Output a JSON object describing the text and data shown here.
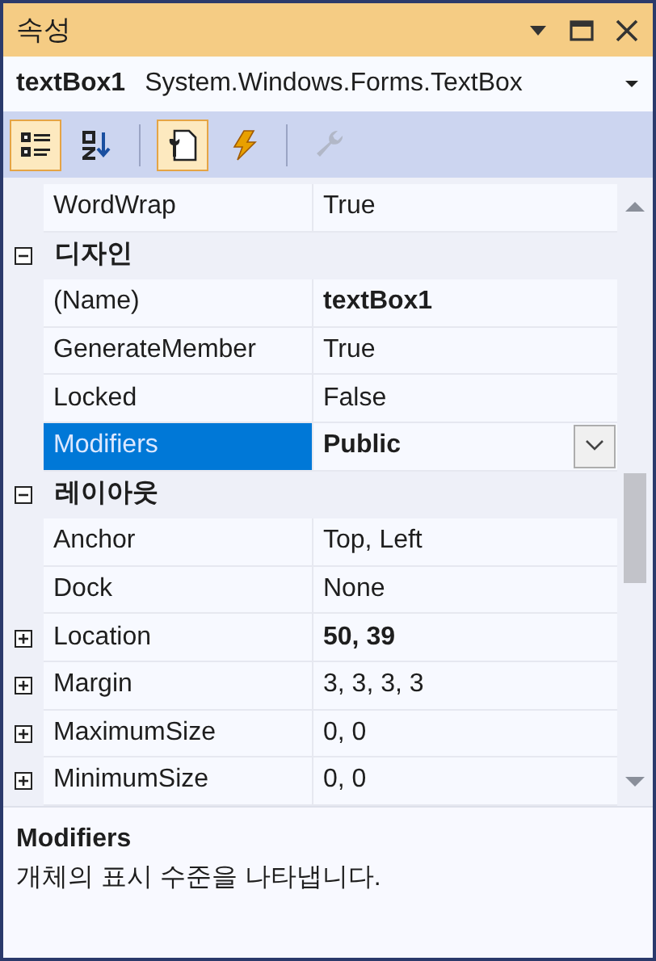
{
  "window": {
    "title": "속성"
  },
  "object_selector": {
    "name": "textBox1",
    "type": "System.Windows.Forms.TextBox"
  },
  "toolbar": [
    {
      "kind": "categorized",
      "selected": true,
      "disabled": false
    },
    {
      "kind": "alphabetical",
      "selected": false,
      "disabled": false
    },
    {
      "kind": "separator"
    },
    {
      "kind": "properties",
      "selected": true,
      "disabled": false
    },
    {
      "kind": "events",
      "selected": false,
      "disabled": false
    },
    {
      "kind": "separator"
    },
    {
      "kind": "property_pages",
      "selected": false,
      "disabled": true
    }
  ],
  "grid": {
    "rows": [
      {
        "kind": "property",
        "name": "WordWrap",
        "value": "True",
        "bold": false,
        "selected": false,
        "expandable": false
      },
      {
        "kind": "category",
        "name": "디자인",
        "expanded": true
      },
      {
        "kind": "property",
        "name": "(Name)",
        "value": "textBox1",
        "bold": true,
        "selected": false,
        "expandable": false
      },
      {
        "kind": "property",
        "name": "GenerateMember",
        "value": "True",
        "bold": false,
        "selected": false,
        "expandable": false
      },
      {
        "kind": "property",
        "name": "Locked",
        "value": "False",
        "bold": false,
        "selected": false,
        "expandable": false
      },
      {
        "kind": "property",
        "name": "Modifiers",
        "value": "Public",
        "bold": true,
        "selected": true,
        "expandable": false
      },
      {
        "kind": "category",
        "name": "레이아웃",
        "expanded": true
      },
      {
        "kind": "property",
        "name": "Anchor",
        "value": "Top, Left",
        "bold": false,
        "selected": false,
        "expandable": false
      },
      {
        "kind": "property",
        "name": "Dock",
        "value": "None",
        "bold": false,
        "selected": false,
        "expandable": false
      },
      {
        "kind": "property",
        "name": "Location",
        "value": "50, 39",
        "bold": true,
        "selected": false,
        "expandable": true
      },
      {
        "kind": "property",
        "name": "Margin",
        "value": "3, 3, 3, 3",
        "bold": false,
        "selected": false,
        "expandable": true
      },
      {
        "kind": "property",
        "name": "MaximumSize",
        "value": "0, 0",
        "bold": false,
        "selected": false,
        "expandable": true
      },
      {
        "kind": "property",
        "name": "MinimumSize",
        "value": "0, 0",
        "bold": false,
        "selected": false,
        "expandable": true
      }
    ]
  },
  "description": {
    "title": "Modifiers",
    "text": "개체의 표시 수준을 나타냅니다."
  }
}
